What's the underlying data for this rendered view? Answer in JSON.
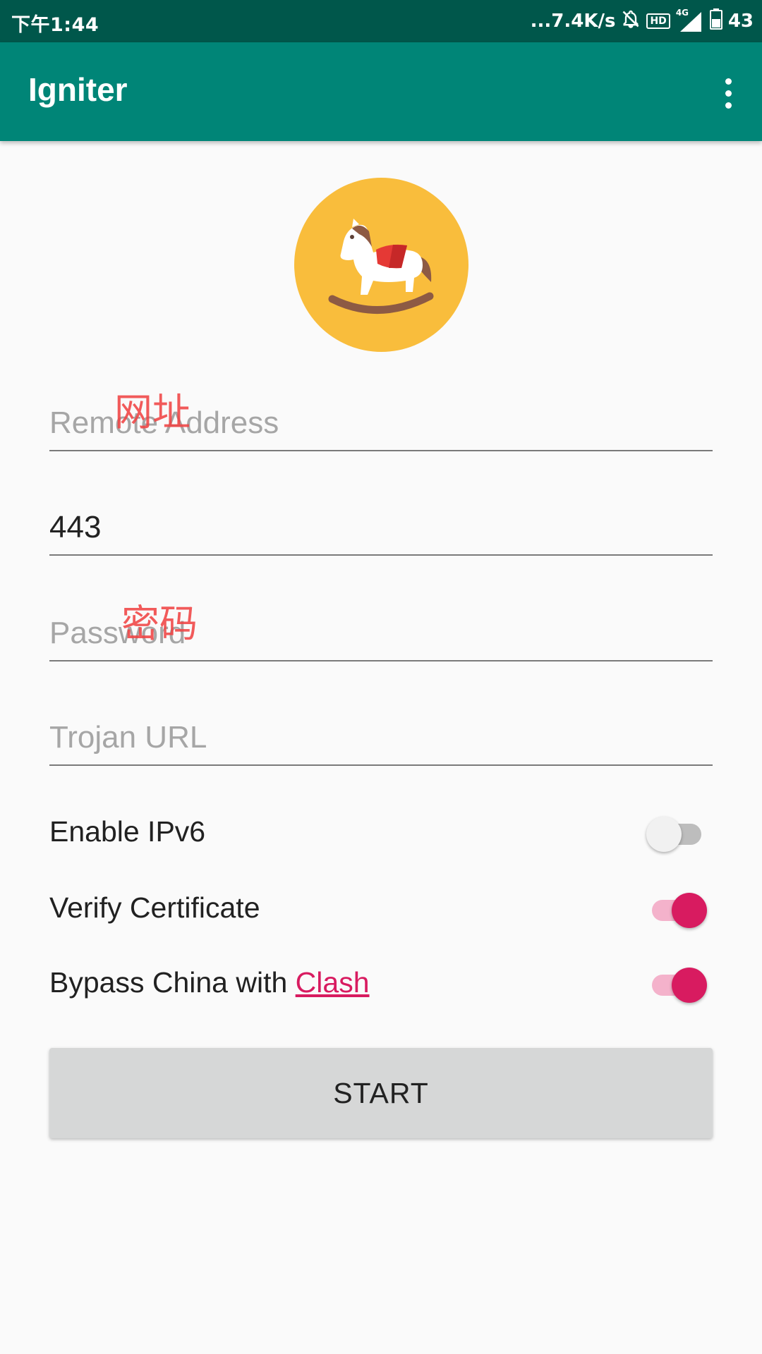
{
  "status_bar": {
    "time": "下午1:44",
    "speed": "...7.4K/s",
    "hd_badge": "HD",
    "network_label": "4G",
    "battery": "43",
    "icons": [
      "mute-icon",
      "hd-icon",
      "signal-icon",
      "battery-icon"
    ]
  },
  "app_bar": {
    "title": "Igniter",
    "menu_icon": "overflow-menu-icon"
  },
  "logo": {
    "icon": "rocking-horse-icon"
  },
  "form": {
    "remote_address": {
      "value": "",
      "placeholder": "Remote Address",
      "annotation": "网址"
    },
    "port": {
      "value": "443",
      "placeholder": ""
    },
    "password": {
      "value": "",
      "placeholder": "Password",
      "annotation": "密码"
    },
    "trojan_url": {
      "value": "",
      "placeholder": "Trojan URL"
    }
  },
  "options": {
    "ipv6": {
      "label": "Enable IPv6",
      "checked": false
    },
    "verify_cert": {
      "label": "Verify Certificate",
      "checked": true
    },
    "bypass_china": {
      "label_prefix": "Bypass China with ",
      "link": "Clash",
      "checked": true
    }
  },
  "start_button": {
    "label": "START"
  },
  "colors": {
    "status_bar": "#00574b",
    "primary": "#008577",
    "accent": "#d81b60",
    "logo_bg": "#f9bd3c",
    "background": "#fafafa"
  }
}
